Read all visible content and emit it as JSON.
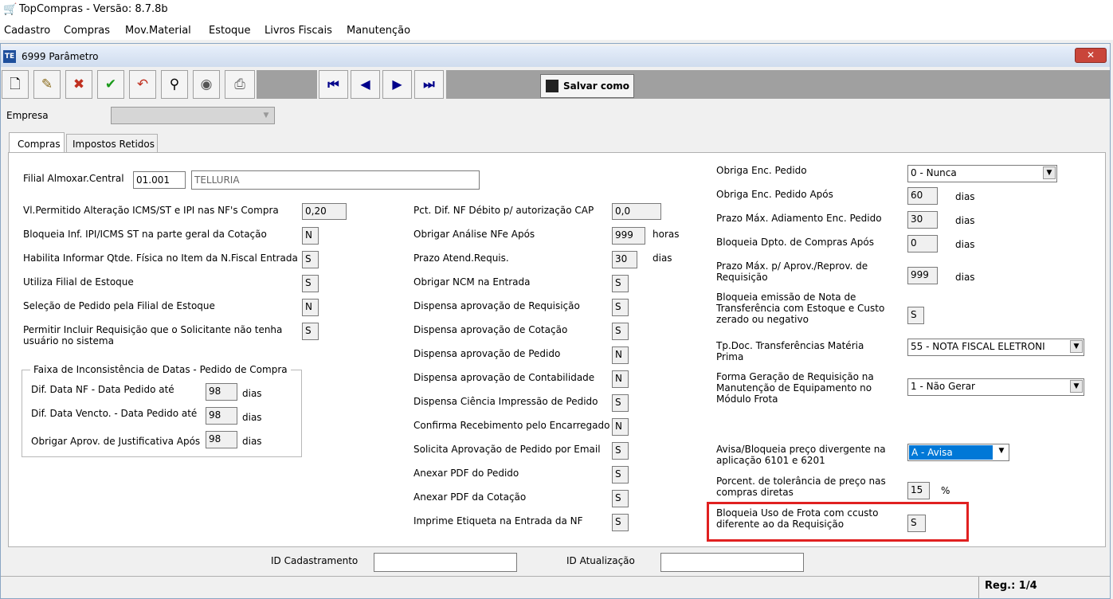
{
  "app": {
    "title": "TopCompras - Versão: 8.7.8b"
  },
  "menu": [
    "Cadastro",
    "Compras",
    "Mov.Material",
    "Estoque",
    "Livros Fiscais",
    "Manutenção"
  ],
  "window": {
    "title": "6999 Parâmetro",
    "close_glyph": "✕"
  },
  "toolbar": {
    "save_as": "Salvar como"
  },
  "empresa": {
    "label": "Empresa",
    "value": ""
  },
  "tabs": [
    "Compras",
    "Impostos Retidos"
  ],
  "col1": {
    "filial_label": "Filial Almoxar.Central",
    "filial_code": "01.001",
    "filial_name": "TELLURIA",
    "rows": [
      {
        "label": "Vl.Permitido Alteração ICMS/ST e IPI nas NF's Compra",
        "value": "0,20"
      },
      {
        "label": "Bloqueia Inf. IPI/ICMS ST na parte geral da Cotação",
        "value": "N"
      },
      {
        "label": "Habilita Informar Qtde. Física no Item da N.Fiscal Entrada",
        "value": "S"
      },
      {
        "label": "Utiliza Filial de Estoque",
        "value": "S"
      },
      {
        "label": "Seleção de Pedido pela Filial de Estoque",
        "value": "N"
      },
      {
        "label": "Permitir Incluir Requisição que o Solicitante não tenha usuário no sistema",
        "value": "S"
      }
    ],
    "group": {
      "title": "Faixa de Inconsistência de Datas - Pedido de Compra",
      "rows": [
        {
          "label": "Dif. Data NF - Data Pedido até",
          "value": "98",
          "unit": "dias"
        },
        {
          "label": "Dif. Data Vencto. - Data Pedido até",
          "value": "98",
          "unit": "dias"
        },
        {
          "label": "Obrigar Aprov. de Justificativa Após",
          "value": "98",
          "unit": "dias"
        }
      ]
    }
  },
  "col2": {
    "rows": [
      {
        "label": "Pct. Dif. NF Débito p/ autorização CAP",
        "value": "0,0",
        "unit": ""
      },
      {
        "label": "Obrigar Análise NFe Após",
        "value": "999",
        "unit": "horas"
      },
      {
        "label": "Prazo Atend.Requis.",
        "value": "30",
        "unit": "dias"
      },
      {
        "label": "Obrigar NCM na Entrada",
        "value": "S",
        "unit": ""
      },
      {
        "label": "Dispensa aprovação de Requisição",
        "value": "S",
        "unit": ""
      },
      {
        "label": "Dispensa aprovação de Cotação",
        "value": "S",
        "unit": ""
      },
      {
        "label": "Dispensa aprovação de Pedido",
        "value": "N",
        "unit": ""
      },
      {
        "label": "Dispensa aprovação de Contabilidade",
        "value": "N",
        "unit": ""
      },
      {
        "label": "Dispensa Ciência Impressão de Pedido",
        "value": "S",
        "unit": ""
      },
      {
        "label": "Confirma Recebimento pelo Encarregado",
        "value": "N",
        "unit": ""
      },
      {
        "label": "Solicita Aprovação de Pedido por Email",
        "value": "S",
        "unit": ""
      },
      {
        "label": "Anexar PDF do Pedido",
        "value": "S",
        "unit": ""
      },
      {
        "label": "Anexar PDF da Cotação",
        "value": "S",
        "unit": ""
      },
      {
        "label": "Imprime Etiqueta na Entrada da NF",
        "value": "S",
        "unit": ""
      }
    ]
  },
  "col3": {
    "obriga_enc": {
      "label": "Obriga Enc. Pedido",
      "value": "0 - Nunca"
    },
    "obriga_enc_apos": {
      "label": "Obriga Enc. Pedido Após",
      "value": "60",
      "unit": "dias"
    },
    "prazo_adiamento": {
      "label": "Prazo Máx. Adiamento Enc. Pedido",
      "value": "30",
      "unit": "dias"
    },
    "bloqueia_dpto": {
      "label": "Bloqueia Dpto. de Compras Após",
      "value": "0",
      "unit": "dias"
    },
    "prazo_aprov": {
      "label": "Prazo Máx. p/ Aprov./Reprov. de Requisição",
      "value": "999",
      "unit": "dias"
    },
    "bloqueia_nota": {
      "label": "Bloqueia emissão de Nota de Transferência com Estoque e Custo zerado ou negativo",
      "value": "S"
    },
    "tpdoc": {
      "label": "Tp.Doc. Transferências Matéria Prima",
      "value": "55 - NOTA FISCAL ELETRONI"
    },
    "forma_geracao": {
      "label": "Forma Geração de Requisição na Manutenção de Equipamento no Módulo Frota",
      "value": "1 - Não Gerar"
    },
    "avisa": {
      "label": "Avisa/Bloqueia preço divergente na aplicação 6101 e 6201",
      "value": "A - Avisa"
    },
    "porcent": {
      "label": "Porcent. de tolerância de preço nas compras diretas",
      "value": "15",
      "unit": "%"
    },
    "bloqueia_frota": {
      "label": "Bloqueia Uso de Frota com ccusto diferente ao da Requisição",
      "value": "S"
    }
  },
  "footer": {
    "id_cad_label": "ID Cadastramento",
    "id_cad_value": "",
    "id_atu_label": "ID Atualização",
    "id_atu_value": "",
    "reg": "Reg.: 1/4"
  },
  "colors": {
    "highlight": "#e02020",
    "selection": "#0078d7",
    "close": "#c9453a"
  }
}
